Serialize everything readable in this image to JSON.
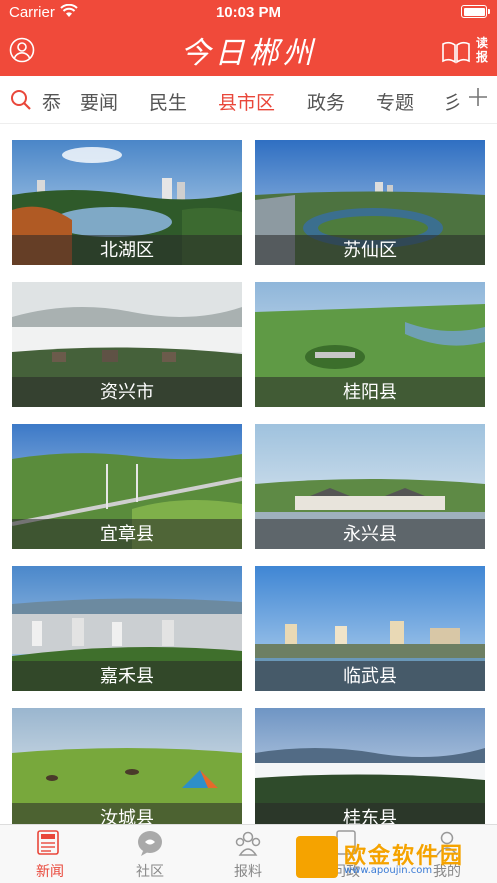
{
  "status_bar": {
    "carrier": "Carrier",
    "time": "10:03 PM",
    "battery_level": 1.0
  },
  "header": {
    "title": "今日郴州",
    "read_label": "读报",
    "profile_icon": "user-circle-icon",
    "read_icon": "book-icon",
    "background_color": "#f04a3a"
  },
  "tabs": {
    "partial_left": "忝",
    "items": [
      "要闻",
      "民生",
      "县市区",
      "政务",
      "专题"
    ],
    "active_index": 2,
    "partial_right": "彡",
    "active_color": "#e9473a"
  },
  "regions": [
    {
      "name": "北湖区"
    },
    {
      "name": "苏仙区"
    },
    {
      "name": "资兴市"
    },
    {
      "name": "桂阳县"
    },
    {
      "name": "宜章县"
    },
    {
      "name": "永兴县"
    },
    {
      "name": "嘉禾县"
    },
    {
      "name": "临武县"
    },
    {
      "name": "汝城县"
    },
    {
      "name": "桂东县"
    }
  ],
  "bottom_tabs": {
    "items": [
      {
        "label": "新闻",
        "icon": "news-icon"
      },
      {
        "label": "社区",
        "icon": "chat-bubble-icon"
      },
      {
        "label": "报料",
        "icon": "people-icon"
      },
      {
        "label": "问政",
        "icon": "document-icon"
      },
      {
        "label": "我的",
        "icon": "person-icon"
      }
    ],
    "active_index": 0
  },
  "watermark": {
    "text": "欧金软件园",
    "url": "www.apoujin.com"
  }
}
